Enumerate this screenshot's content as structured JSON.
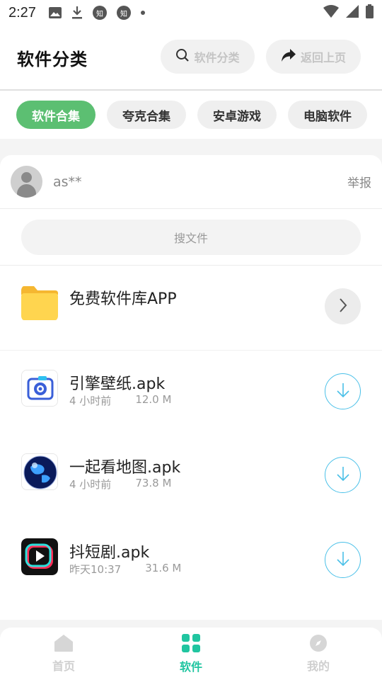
{
  "status_bar": {
    "time": "2:27",
    "notif_icons": [
      "image-icon",
      "download-icon",
      "zhihu-icon",
      "zhihu-icon",
      "dot-icon"
    ],
    "zhihu_glyph": "知",
    "right_icons": [
      "wifi-icon",
      "signal-icon",
      "battery-icon"
    ]
  },
  "header": {
    "title": "软件分类",
    "search_label": "软件分类",
    "back_label": "返回上页"
  },
  "tabs": [
    {
      "label": "软件合集",
      "active": true
    },
    {
      "label": "夸克合集",
      "active": false
    },
    {
      "label": "安卓游戏",
      "active": false
    },
    {
      "label": "电脑软件",
      "active": false
    }
  ],
  "user": {
    "name": "as**",
    "report_label": "举报"
  },
  "search": {
    "placeholder": "搜文件"
  },
  "folder": {
    "name": "免费软件库APP",
    "icon": "folder-icon"
  },
  "files": [
    {
      "name": "引擎壁纸.apk",
      "time": "4 小时前",
      "size": "12.0 M",
      "icon": "wallpaper-app-icon"
    },
    {
      "name": "一起看地图.apk",
      "time": "4 小时前",
      "size": "73.8 M",
      "icon": "globe-app-icon"
    },
    {
      "name": "抖短剧.apk",
      "time": "昨天10:37",
      "size": "31.6 M",
      "icon": "video-app-icon"
    }
  ],
  "bottom_nav": [
    {
      "label": "首页",
      "icon": "home-icon",
      "active": false
    },
    {
      "label": "软件",
      "icon": "grid-icon",
      "active": true
    },
    {
      "label": "我的",
      "icon": "compass-icon",
      "active": false
    }
  ],
  "colors": {
    "accent_green": "#5cbf72",
    "nav_active": "#20c5a0",
    "download_blue": "#4ac0e8",
    "folder_yellow": "#ffd54f"
  }
}
